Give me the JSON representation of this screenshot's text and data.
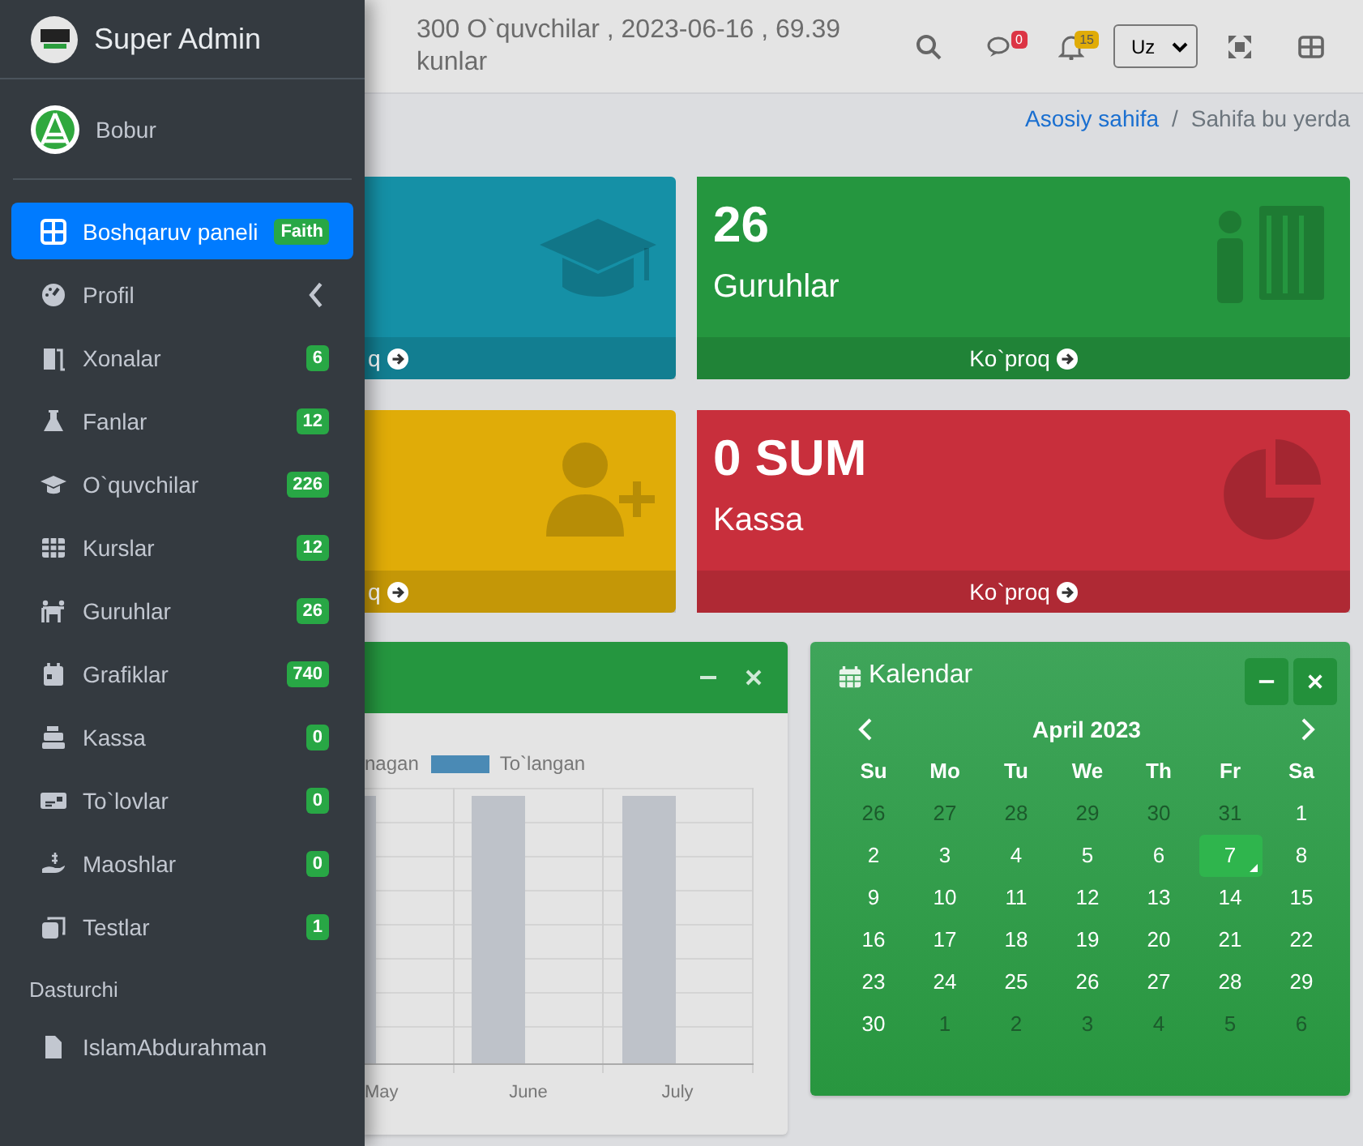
{
  "sidebar": {
    "brand": "Super Admin",
    "user": "Bobur",
    "items": [
      {
        "label": "Boshqaruv paneli",
        "badge": "Faith",
        "selected": true,
        "kind": "link"
      },
      {
        "label": "Profil",
        "selected": false,
        "kind": "expandable"
      },
      {
        "label": "Xonalar",
        "badge": "6",
        "selected": false,
        "kind": "link"
      },
      {
        "label": "Fanlar",
        "badge": "12",
        "selected": false,
        "kind": "link"
      },
      {
        "label": "O`quvchilar",
        "badge": "226",
        "selected": false,
        "kind": "link"
      },
      {
        "label": "Kurslar",
        "badge": "12",
        "selected": false,
        "kind": "link"
      },
      {
        "label": "Guruhlar",
        "badge": "26",
        "selected": false,
        "kind": "link"
      },
      {
        "label": "Grafiklar",
        "badge": "740",
        "selected": false,
        "kind": "link"
      },
      {
        "label": "Kassa",
        "badge": "0",
        "selected": false,
        "kind": "link"
      },
      {
        "label": "To`lovlar",
        "badge": "0",
        "selected": false,
        "kind": "link"
      },
      {
        "label": "Maoshlar",
        "badge": "0",
        "selected": false,
        "kind": "link"
      },
      {
        "label": "Testlar",
        "badge": "1",
        "selected": false,
        "kind": "link"
      }
    ],
    "section_header": "Dasturchi",
    "section_items": [
      {
        "label": "IslamAbdurahman",
        "selected": false
      }
    ]
  },
  "topbar": {
    "title": "300 O`quvchilar , 2023-06-16 , 69.39 kunlar",
    "messages_badge": "0",
    "notifications_badge": "15",
    "language": "Uz"
  },
  "breadcrumb": {
    "link": "Asosiy sahifa",
    "separator": "/",
    "current": "Sahifa bu yerda"
  },
  "cards": [
    {
      "footer": "q",
      "color": "#1590a6",
      "clipped": true
    },
    {
      "value": "26",
      "label": "Guruhlar",
      "footer": "Ko`proq",
      "color": "#25963f",
      "clipped": false
    },
    {
      "footer": "q",
      "color": "#e0ac08",
      "clipped": true
    },
    {
      "value": "0 SUM",
      "label": "Kassa",
      "footer": "Ko`proq",
      "color": "#c82f3c",
      "clipped": false
    }
  ],
  "chart_panel": {
    "legend": [
      {
        "label": "nagan"
      },
      {
        "label": "To`langan",
        "color": "#4a8ab5"
      }
    ],
    "x_labels": [
      "May",
      "June",
      "July"
    ]
  },
  "calendar": {
    "title": "Kalendar",
    "month": "April 2023",
    "weekdays": [
      "Su",
      "Mo",
      "Tu",
      "We",
      "Th",
      "Fr",
      "Sa"
    ],
    "weeks": [
      [
        {
          "day": "26",
          "muted": true,
          "selected": false
        },
        {
          "day": "27",
          "muted": true,
          "selected": false
        },
        {
          "day": "28",
          "muted": true,
          "selected": false
        },
        {
          "day": "29",
          "muted": true,
          "selected": false
        },
        {
          "day": "30",
          "muted": true,
          "selected": false
        },
        {
          "day": "31",
          "muted": true,
          "selected": false
        },
        {
          "day": "1",
          "muted": false,
          "selected": false
        }
      ],
      [
        {
          "day": "2",
          "muted": false,
          "selected": false
        },
        {
          "day": "3",
          "muted": false,
          "selected": false
        },
        {
          "day": "4",
          "muted": false,
          "selected": false
        },
        {
          "day": "5",
          "muted": false,
          "selected": false
        },
        {
          "day": "6",
          "muted": false,
          "selected": false
        },
        {
          "day": "7",
          "muted": false,
          "selected": true
        },
        {
          "day": "8",
          "muted": false,
          "selected": false
        }
      ],
      [
        {
          "day": "9",
          "muted": false,
          "selected": false
        },
        {
          "day": "10",
          "muted": false,
          "selected": false
        },
        {
          "day": "11",
          "muted": false,
          "selected": false
        },
        {
          "day": "12",
          "muted": false,
          "selected": false
        },
        {
          "day": "13",
          "muted": false,
          "selected": false
        },
        {
          "day": "14",
          "muted": false,
          "selected": false
        },
        {
          "day": "15",
          "muted": false,
          "selected": false
        }
      ],
      [
        {
          "day": "16",
          "muted": false,
          "selected": false
        },
        {
          "day": "17",
          "muted": false,
          "selected": false
        },
        {
          "day": "18",
          "muted": false,
          "selected": false
        },
        {
          "day": "19",
          "muted": false,
          "selected": false
        },
        {
          "day": "20",
          "muted": false,
          "selected": false
        },
        {
          "day": "21",
          "muted": false,
          "selected": false
        },
        {
          "day": "22",
          "muted": false,
          "selected": false
        }
      ],
      [
        {
          "day": "23",
          "muted": false,
          "selected": false
        },
        {
          "day": "24",
          "muted": false,
          "selected": false
        },
        {
          "day": "25",
          "muted": false,
          "selected": false
        },
        {
          "day": "26",
          "muted": false,
          "selected": false
        },
        {
          "day": "27",
          "muted": false,
          "selected": false
        },
        {
          "day": "28",
          "muted": false,
          "selected": false
        },
        {
          "day": "29",
          "muted": false,
          "selected": false
        }
      ],
      [
        {
          "day": "30",
          "muted": false,
          "selected": false
        },
        {
          "day": "1",
          "muted": true,
          "selected": false
        },
        {
          "day": "2",
          "muted": true,
          "selected": false
        },
        {
          "day": "3",
          "muted": true,
          "selected": false
        },
        {
          "day": "4",
          "muted": true,
          "selected": false
        },
        {
          "day": "5",
          "muted": true,
          "selected": false
        },
        {
          "day": "6",
          "muted": true,
          "selected": false
        }
      ]
    ]
  }
}
